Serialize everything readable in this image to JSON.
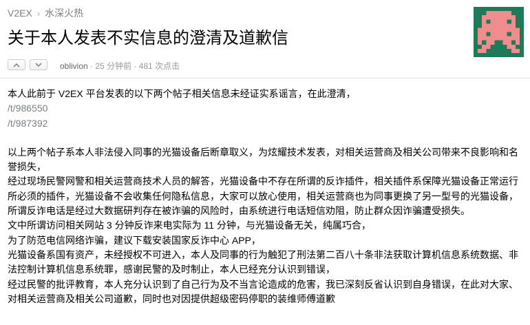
{
  "breadcrumb": {
    "site": "V2EX",
    "separator": "›",
    "node": "水深火热"
  },
  "topic": {
    "title": "关于本人发表不实信息的澄清及道歉信",
    "author": "oblivion",
    "time": "25 分钟前",
    "views": "481 次点击",
    "dot": "·"
  },
  "content": {
    "intro": "本人此前于 V2EX 平台发表的以下两个帖子相关信息未经证实系谣言，在此澄清，",
    "links": [
      "/t/986550",
      "/t/987392"
    ],
    "paragraphs": [
      "以上两个帖子系本人非法侵入同事的光猫设备后断章取义，为炫耀技术发表，对相关运营商及相关公司带来不良影响和名誉损失，",
      "经过现场民警网警和相关运营商技术人员的解答，光猫设备中不存在所谓的反诈插件，相关插件系保障光猫设备正常运行所必须的插件，光猫设备不会收集任何隐私信息，大家可以放心使用，相关运营商也为同事更换了另一型号的光猫设备，所谓反诈电话是经过大数据研判存在被诈骗的风险时，由系统进行电话短信劝阻，防止群众因诈骗遭受损失。",
      "文中所谓访问相关网站 3 分钟反诈来电实际为 11 分钟，与光猫设备无关，纯属巧合，",
      "为了防范电信网络诈骗，建议下载安装国家反诈中心 APP，",
      "光猫设备系国有资产，未经授权不可进入，本人及同事的行为触犯了刑法第二百八十条非法获取计算机信息系统数据、非法控制计算机信息系统罪，感谢民警的及时制止，本人已经充分认识到错误，",
      "经过民警的批评教育，本人充分认识到了自己行为及不当言论造成的危害，我已深刻反省认识到自身错误，在此对大家、对相关运营商及相关公司道歉，同时也对因提供超级密码停职的装维师傅道歉"
    ]
  },
  "colors": {
    "avatar_bg": "#1f7a5a",
    "avatar_fg": "#f08c8c",
    "muted": "#778087"
  },
  "icons": {
    "upvote": "chevron-up-icon",
    "downvote": "chevron-down-icon"
  }
}
